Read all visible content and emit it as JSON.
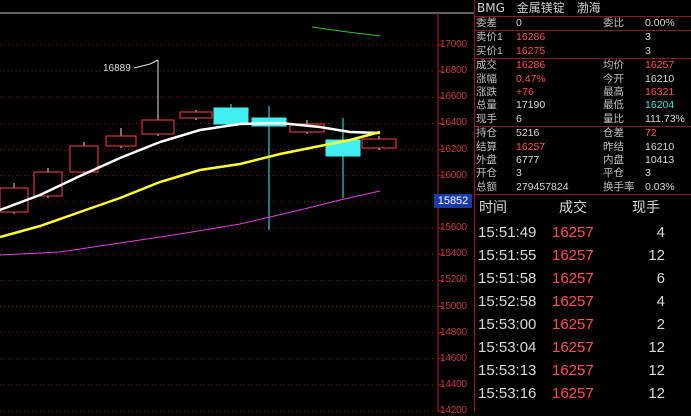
{
  "chart": {
    "y_ticks": [
      "17000",
      "16800",
      "16600",
      "16400",
      "16200",
      "16000",
      "15800",
      "15600",
      "15400",
      "15200",
      "15000",
      "14800",
      "14600",
      "14400",
      "14200"
    ],
    "last_price_label": "15852",
    "peak_label": "16889",
    "colors": {
      "up": "#ff4040",
      "down": "#40f0f0",
      "ma_fast": "#ffffff",
      "ma_mid": "#ffff30",
      "ma_slow": "#e040e0",
      "ma_top": "#30c030"
    }
  },
  "header": {
    "code": "BMG",
    "name": "金属镁锭",
    "exchange": "渤海"
  },
  "quote": {
    "rows1": [
      {
        "l": "委差",
        "v": "0",
        "vc": "white",
        "l2": "委比",
        "v2": "0.00%",
        "v2c": "white"
      }
    ],
    "rows2": [
      {
        "l": "卖价1",
        "v": "16286",
        "vc": "red",
        "l2": "",
        "v2": "3",
        "v2c": "white"
      },
      {
        "l": "买价1",
        "v": "16275",
        "vc": "red",
        "l2": "",
        "v2": "3",
        "v2c": "white"
      }
    ],
    "rows3": [
      {
        "l": "成交",
        "v": "16286",
        "vc": "red",
        "l2": "均价",
        "v2": "16257",
        "v2c": "red"
      },
      {
        "l": "涨幅",
        "v": "0.47%",
        "vc": "red",
        "l2": "今开",
        "v2": "16210",
        "v2c": "white"
      },
      {
        "l": "涨跌",
        "v": "+76",
        "vc": "red",
        "l2": "最高",
        "v2": "16321",
        "v2c": "red"
      },
      {
        "l": "总量",
        "v": "17190",
        "vc": "white",
        "l2": "最低",
        "v2": "16204",
        "v2c": "cyan"
      },
      {
        "l": "现手",
        "v": "6",
        "vc": "white",
        "l2": "量比",
        "v2": "111.73%",
        "v2c": "white"
      }
    ],
    "rows4": [
      {
        "l": "持仓",
        "v": "5216",
        "vc": "white",
        "l2": "仓差",
        "v2": "72",
        "v2c": "red"
      },
      {
        "l": "结算",
        "v": "16257",
        "vc": "red",
        "l2": "昨结",
        "v2": "16210",
        "v2c": "white"
      },
      {
        "l": "外盘",
        "v": "6777",
        "vc": "white",
        "l2": "内盘",
        "v2": "10413",
        "v2c": "white"
      },
      {
        "l": "开仓",
        "v": "3",
        "vc": "white",
        "l2": "平仓",
        "v2": "3",
        "v2c": "white"
      },
      {
        "l": "总额",
        "v": "279457824",
        "vc": "white",
        "l2": "换手率",
        "v2": "0.03%",
        "v2c": "white"
      }
    ]
  },
  "trades": {
    "headers": {
      "time": "时间",
      "price": "成交",
      "vol": "现手"
    },
    "rows": [
      {
        "time": "15:51:49",
        "price": "16257",
        "vol": "4"
      },
      {
        "time": "15:51:55",
        "price": "16257",
        "vol": "12"
      },
      {
        "time": "15:51:58",
        "price": "16257",
        "vol": "6"
      },
      {
        "time": "15:52:58",
        "price": "16257",
        "vol": "4"
      },
      {
        "time": "15:53:00",
        "price": "16257",
        "vol": "2"
      },
      {
        "time": "15:53:04",
        "price": "16257",
        "vol": "12"
      },
      {
        "time": "15:53:13",
        "price": "16257",
        "vol": "12"
      },
      {
        "time": "15:53:16",
        "price": "16257",
        "vol": "12"
      }
    ]
  }
}
